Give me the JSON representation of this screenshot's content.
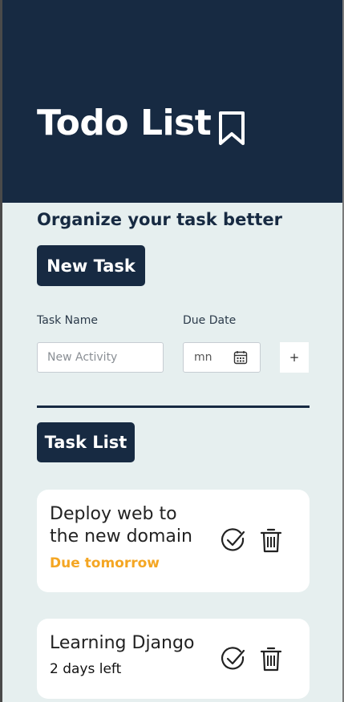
{
  "header": {
    "title": "Todo List",
    "icon": "bookmark-icon"
  },
  "subtitle": "Organize your task better",
  "new_task_button": "New Task",
  "form": {
    "task_name_label": "Task Name",
    "task_name_placeholder": "New Activity",
    "due_date_label": "Due Date",
    "due_date_value": "mn",
    "add_button": "+"
  },
  "task_list_button": "Task List",
  "tasks": [
    {
      "title": "Deploy web to the new domain",
      "due": "Due tomorrow",
      "due_color": "#f4a623"
    },
    {
      "title": "Learning Django",
      "due": "2 days left",
      "due_color": "#111111"
    }
  ],
  "colors": {
    "primary": "#172a42",
    "background": "#e6efef",
    "warning": "#f4a623"
  }
}
